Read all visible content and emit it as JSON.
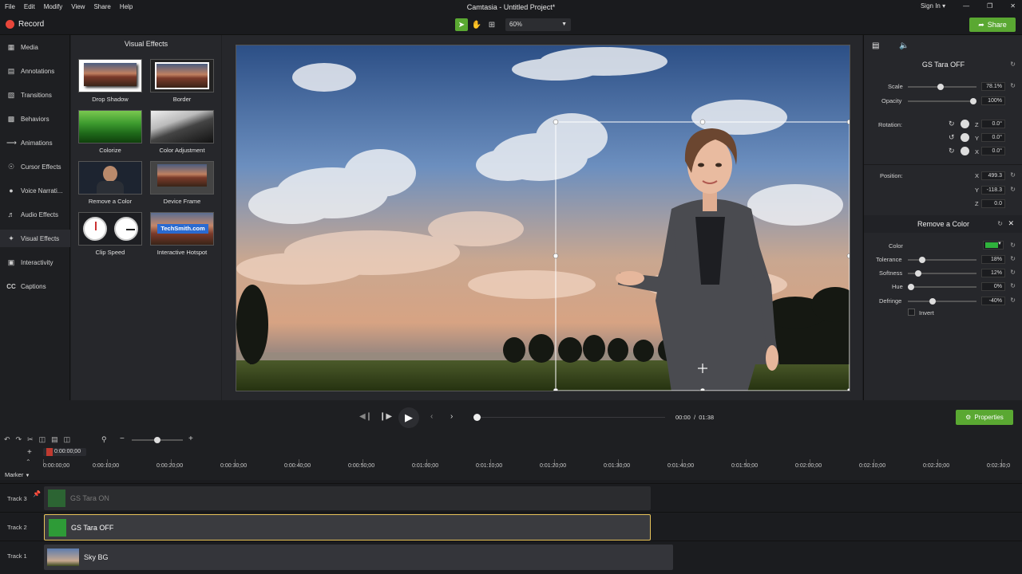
{
  "menu": [
    "File",
    "Edit",
    "Modify",
    "View",
    "Share",
    "Help"
  ],
  "window_title": "Camtasia - Untitled Project*",
  "signin": "Sign In",
  "record_label": "Record",
  "zoom_value": "60%",
  "share_label": "Share",
  "sidebar": {
    "items": [
      {
        "label": "Media",
        "icon": "media-icon"
      },
      {
        "label": "Annotations",
        "icon": "annotations-icon"
      },
      {
        "label": "Transitions",
        "icon": "transitions-icon"
      },
      {
        "label": "Behaviors",
        "icon": "behaviors-icon"
      },
      {
        "label": "Animations",
        "icon": "animations-icon"
      },
      {
        "label": "Cursor Effects",
        "icon": "cursor-effects-icon"
      },
      {
        "label": "Voice Narrati...",
        "icon": "microphone-icon"
      },
      {
        "label": "Audio Effects",
        "icon": "audio-effects-icon"
      },
      {
        "label": "Visual Effects",
        "icon": "visual-effects-icon"
      },
      {
        "label": "Interactivity",
        "icon": "interactivity-icon"
      },
      {
        "label": "Captions",
        "icon": "captions-icon"
      }
    ]
  },
  "visual_effects": {
    "title": "Visual Effects",
    "effects": [
      "Drop Shadow",
      "Border",
      "Colorize",
      "Color Adjustment",
      "Remove a Color",
      "Device Frame",
      "Clip Speed",
      "Interactive Hotspot"
    ],
    "hotspot_text": "TechSmith.com"
  },
  "properties": {
    "clip_title": "GS Tara OFF",
    "scale_label": "Scale",
    "scale_value": "78.1%",
    "scale_level": 0.47,
    "opacity_label": "Opacity",
    "opacity_value": "100%",
    "opacity_level": 1.0,
    "rotation_label": "Rotation:",
    "rot_z_axis": "Z",
    "rot_z": "0.0°",
    "rot_y_axis": "Y",
    "rot_y": "0.0°",
    "rot_x_axis": "X",
    "rot_x": "0.0°",
    "position_label": "Position:",
    "pos_x_axis": "X",
    "pos_x": "499.3",
    "pos_y_axis": "Y",
    "pos_y": "-118.3",
    "pos_z_axis": "Z",
    "pos_z": "0.0",
    "effect_title": "Remove a Color",
    "color_label": "Color",
    "color_swatch": "#2fb33c",
    "tolerance_label": "Tolerance",
    "tolerance_value": "18%",
    "tolerance_level": 0.18,
    "softness_label": "Softness",
    "softness_value": "12%",
    "softness_level": 0.12,
    "hue_label": "Hue",
    "hue_value": "0%",
    "hue_level": 0.0,
    "defringe_label": "Defringe",
    "defringe_value": "-40%",
    "invert_label": "Invert"
  },
  "playback": {
    "current": "00:00",
    "separator": "/",
    "total": "01:38"
  },
  "timeline": {
    "playhead_time": "0:00:00;00",
    "ruler": [
      "0:00:00;00",
      "0:00:10;00",
      "0:00:20;00",
      "0:00:30;00",
      "0:00:40;00",
      "0:00:50;00",
      "0:01:00;00",
      "0:01:10;00",
      "0:01:20;00",
      "0:01:30;00",
      "0:01:40;00",
      "0:01:50;00",
      "0:02:00;00",
      "0:02:10;00",
      "0:02:20;00",
      "0:02:30;0"
    ],
    "marker_label": "Marker",
    "tracks": [
      {
        "label": "Track 3",
        "clip": "GS Tara ON"
      },
      {
        "label": "Track 2",
        "clip": "GS Tara OFF"
      },
      {
        "label": "Track 1",
        "clip": "Sky BG"
      }
    ]
  },
  "colors": {
    "accent": "#5aa832",
    "record": "#e8463a",
    "clip_selected_border": "#e8c35a"
  }
}
